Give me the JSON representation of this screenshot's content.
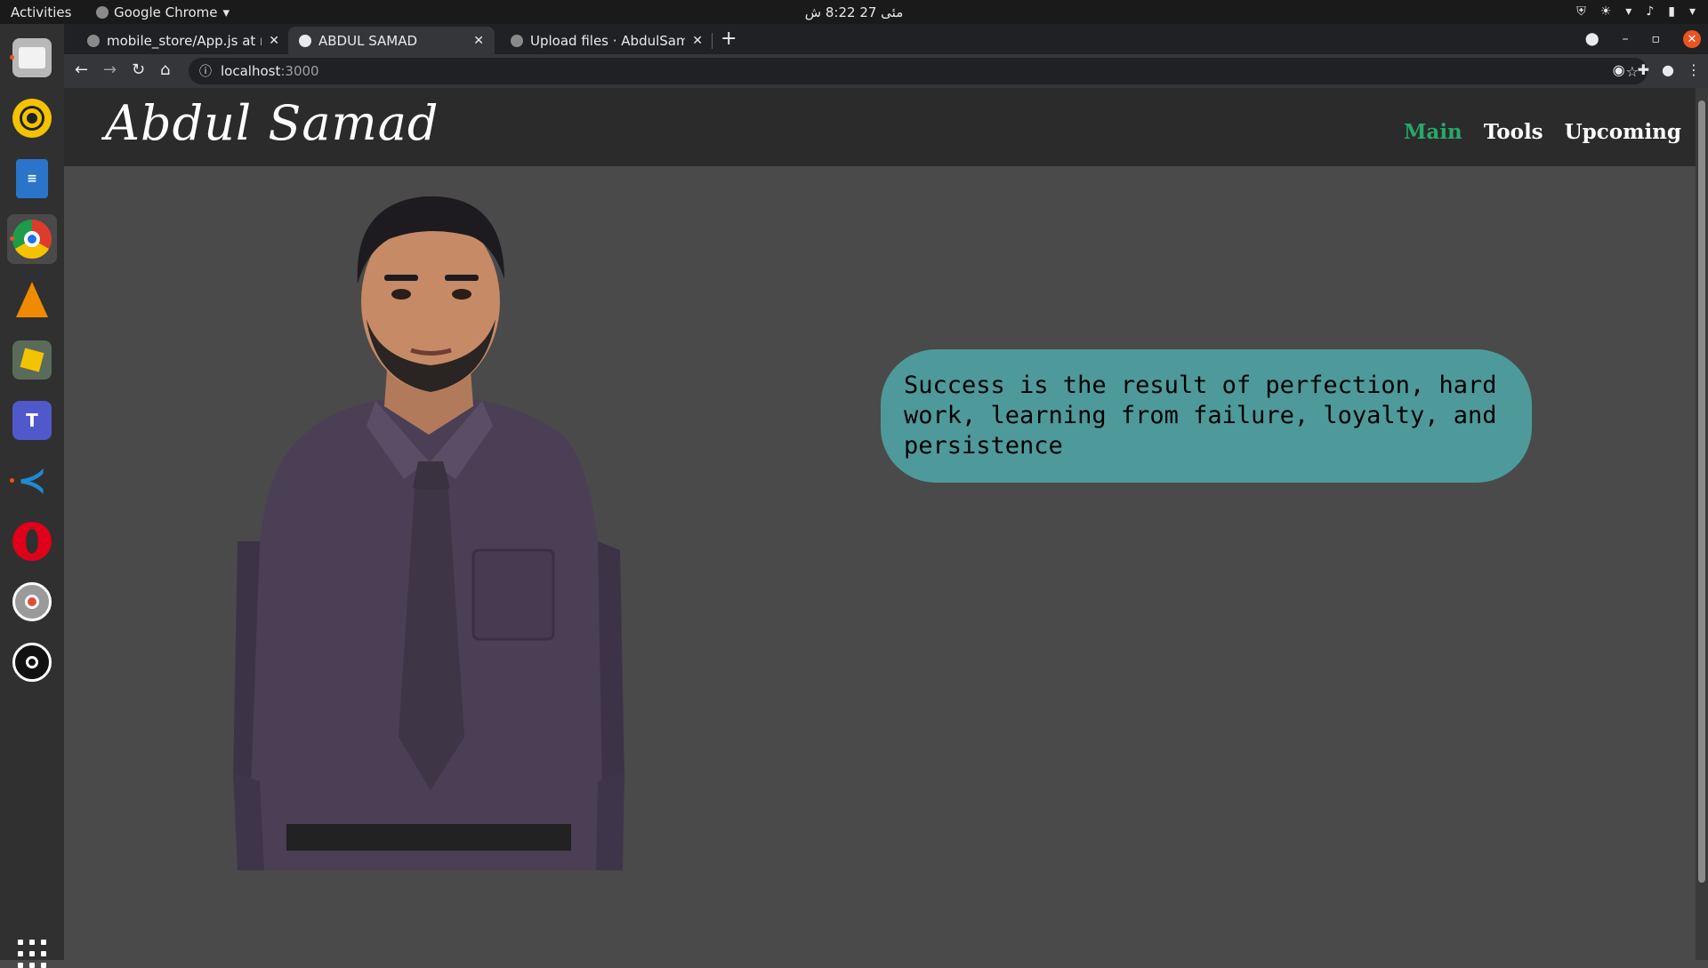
{
  "topbar": {
    "activities": "Activities",
    "app_name": "Google Chrome",
    "clock": "مئی 27  8:22 ش"
  },
  "dock": {
    "items": [
      {
        "icon": "files-icon",
        "color": "#8a8a8a"
      },
      {
        "icon": "rhythmbox-icon",
        "color": "#f4c300"
      },
      {
        "icon": "libreoffice-writer-icon",
        "color": "#2a74c9"
      },
      {
        "icon": "chrome-icon",
        "color": "#dd3b2c"
      },
      {
        "icon": "vlc-icon",
        "color": "#f08a00"
      },
      {
        "icon": "gnome-boxes-icon",
        "color": "#6b8c2a"
      },
      {
        "icon": "teams-icon",
        "color": "#5059c9",
        "glyph": "T"
      },
      {
        "icon": "vscode-icon",
        "color": "#1f8ad2"
      },
      {
        "icon": "opera-icon",
        "color": "#e0001a"
      },
      {
        "icon": "lifesaver-icon",
        "color": "#9a9a9a"
      },
      {
        "icon": "obs-icon",
        "color": "#111111"
      }
    ]
  },
  "browser": {
    "tabs": [
      {
        "title": "mobile_store/App.js at m"
      },
      {
        "title": "ABDUL SAMAD"
      },
      {
        "title": "Upload files · AbdulSamad"
      }
    ],
    "url_host": "localhost",
    "url_port": ":3000"
  },
  "site": {
    "brand": "Abdul Samad",
    "nav": [
      "Main",
      "Tools",
      "Upcoming"
    ],
    "quote": "Success is the result of perfection, hard work, learning from failure, loyalty, and persistence",
    "colors": {
      "accent": "#26a86a",
      "bubble": "#4e9a9a",
      "header": "#2b2b2b",
      "background": "#4a4a4a"
    }
  }
}
